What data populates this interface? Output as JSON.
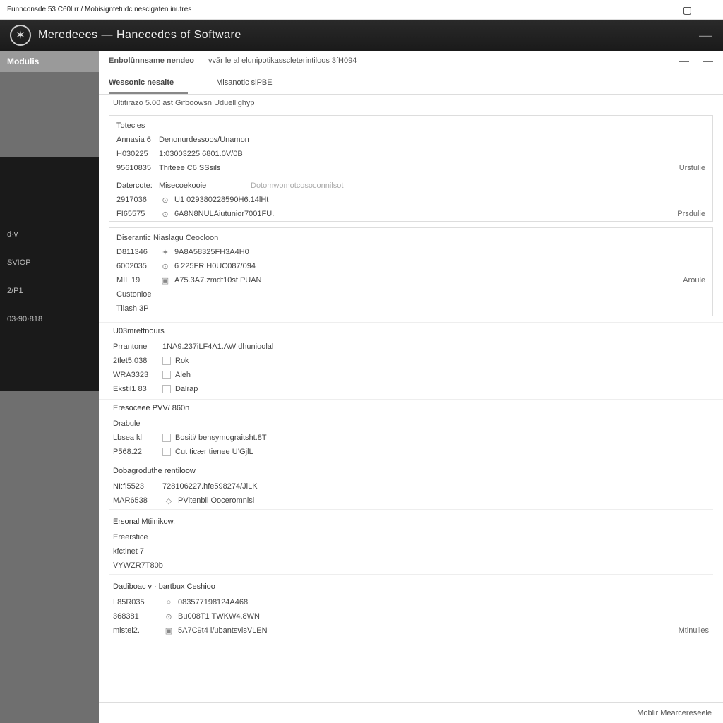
{
  "window": {
    "title": "Funnconsde 53 C60l rr / Mobisigntetudc nescigaten inutres",
    "min_icon": "—",
    "max_icon": "▢",
    "close_icon": "—"
  },
  "header": {
    "title": "Meredeees — Hanecedes of Software",
    "right": "—"
  },
  "sidebar": {
    "items": [
      {
        "label": "Modulis"
      }
    ],
    "dark_items": [
      {
        "label": "d·v"
      },
      {
        "label": "SVIOP"
      },
      {
        "label": "2/P1"
      },
      {
        "label": "03·90·818"
      }
    ]
  },
  "breadcrumb": {
    "item1": "Enbolûnnsame nendeo",
    "item2": "vvăr le al elunipotikasscleterintiloos 3fH094"
  },
  "tabs": [
    {
      "label": "Wessonic nesalte",
      "active": true
    },
    {
      "label": "Misanotic siPBE",
      "active": false
    }
  ],
  "subheader": "Ultitirazo   5.00 ast Gifboowsn Uduellighyp",
  "sections": {
    "totecles": {
      "title": "Totecles",
      "header_col1": "Annasia 6",
      "header_col2": "Denonurdessoos/Unamon",
      "rows": [
        {
          "code": "H030225",
          "value": "1:03003225 6801.0V/0B"
        },
        {
          "code": "95610835",
          "value": "Thiteee C6 SSsils",
          "action": "Urstulie"
        }
      ],
      "subhead_col1": "Datercote:",
      "subhead_col2": "Misecoekooie",
      "subhead_col3": "Dotomwomotcosoconnilsot",
      "rows2": [
        {
          "code": "2917036",
          "icon": "⊙",
          "value": "U1 029380228590H6.14lHt"
        },
        {
          "code": "FI65575",
          "icon": "⊙",
          "value": "6A8N8NULAiutunior7001FU.",
          "action": "Prsdulie"
        }
      ]
    },
    "diagnostic": {
      "title": "Diserantic Niaslagu Ceocloon",
      "rows": [
        {
          "code": "D811346",
          "icon": "✦",
          "value": "9A8A58325FH3A4H0"
        },
        {
          "code": "6002035",
          "icon": "⊙",
          "value": "6 225FR H0UC087/094"
        },
        {
          "code": "MIL 19",
          "icon": "▣",
          "value": "A75.3A7.zmdf10st PUAN",
          "action": "Aroule"
        }
      ],
      "extra": [
        "Custonloe",
        "Tilash 3P"
      ]
    },
    "u0": {
      "title": "U03mrettnours",
      "header_col1": "Prrantone",
      "header_col2": "1NA9.237iLF4A1.AW dhunioolal",
      "rows": [
        {
          "code": "2tlet5.038",
          "value": "Rok"
        },
        {
          "code": "WRA3323",
          "value": "Aleh"
        },
        {
          "code": "Ekstil1 83",
          "value": "Dalrap"
        }
      ]
    },
    "eresoceee": {
      "title": "Eresoceee PVV/ 860n",
      "pre": "Drabule",
      "rows": [
        {
          "code": "Lbsea kl",
          "value": "Bositi/ bensymograitsht.8T"
        },
        {
          "code": "P568.22",
          "value": "Cut ticær tienee U’GjlL"
        }
      ]
    },
    "dobas": {
      "title": "Dobagroduthe rentiloow",
      "rows": [
        {
          "code": "NI:fi5523",
          "value": "728106227.hfe598274/JiLK"
        },
        {
          "code": "MAR6538",
          "icon": "◇",
          "value": "PVltenbll Ooceromnisl"
        }
      ]
    },
    "ersenal": {
      "title": "Ersonal Mtiinikow.",
      "lines": [
        "Ereerstice",
        "kfctinet 7",
        "VYWZR7T80b"
      ]
    },
    "dadb": {
      "title": "Dadiboac v · bartbux Ceshioo",
      "rows": [
        {
          "code": "L85R035",
          "icon": "○",
          "value": "083577198124A468"
        },
        {
          "code": "368381",
          "icon": "⊙",
          "value": "Bu008T1 TWKW4.8WN"
        },
        {
          "code": "mistel2.",
          "icon": "▣",
          "value": "5A7C9t4 l/ubantsvisVLEN",
          "action": "Mtinulies"
        }
      ]
    }
  },
  "footer": {
    "text": "Moblir Mearcereseele"
  }
}
